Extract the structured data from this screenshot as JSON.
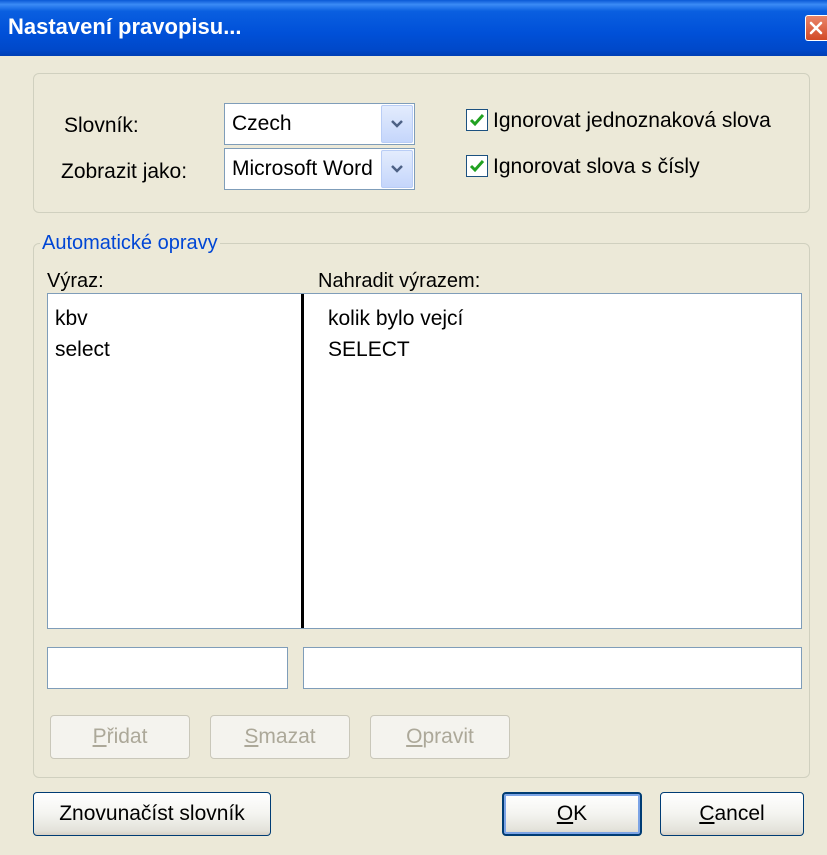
{
  "window": {
    "title": "Nastavení pravopisu..."
  },
  "settings": {
    "dictionary_label": "Slovník:",
    "dictionary_value": "Czech",
    "display_label": "Zobrazit jako:",
    "display_value": "Microsoft Word",
    "ignore_single_char_label": "Ignorovat jednoznaková slova",
    "ignore_single_char_checked": true,
    "ignore_numbers_label": "Ignorovat slova s čísly",
    "ignore_numbers_checked": true
  },
  "autocorrect": {
    "group_title": "Automatické opravy",
    "col_expression": "Výraz:",
    "col_replacement": "Nahradit výrazem:",
    "rows": [
      {
        "expression": "kbv",
        "replacement": "kolik bylo vejcí"
      },
      {
        "expression": "select",
        "replacement": "SELECT"
      }
    ],
    "expression_input_value": "",
    "replacement_input_value": "",
    "buttons": {
      "add": {
        "label": "Přidat",
        "mnemonic": "P",
        "rest": "řidat"
      },
      "delete": {
        "label": "Smazat",
        "mnemonic": "S",
        "rest": "mazat"
      },
      "edit": {
        "label": "Opravit",
        "mnemonic": "O",
        "rest": "pravit"
      }
    }
  },
  "footer": {
    "reload_label": "Znovunačíst slovník",
    "ok": {
      "label": "OK",
      "mnemonic": "O",
      "rest": "K"
    },
    "cancel": {
      "label": "Cancel",
      "mnemonic": "C",
      "rest": "ancel"
    }
  },
  "colors": {
    "titlebar": "#0050d8",
    "dialog_bg": "#ece9d8",
    "group_title": "#0046d5",
    "checkmark": "#21a121",
    "disabled_text": "#aca899"
  }
}
